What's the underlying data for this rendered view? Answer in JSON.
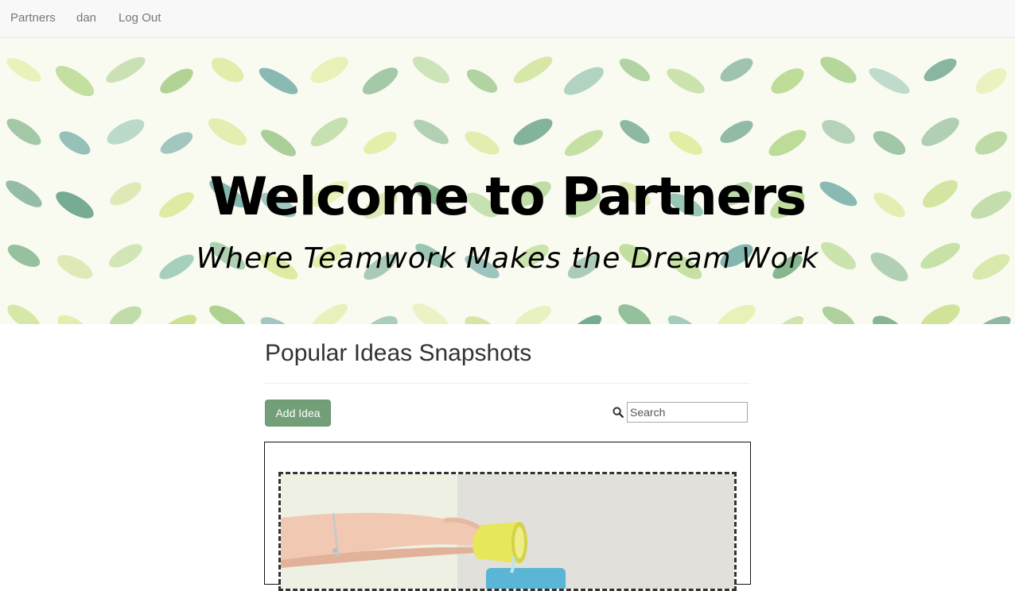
{
  "navbar": {
    "brand": "Partners",
    "user": "dan",
    "logout": "Log Out"
  },
  "hero": {
    "title": "Welcome to Partners",
    "subtitle": "Where Teamwork Makes the Dream Work"
  },
  "main": {
    "title": "Popular Ideas Snapshots",
    "add_idea_label": "Add Idea",
    "search_placeholder": "Search",
    "search_icon": "search-icon"
  },
  "snapshot": {
    "image_description": "hand-pouring-yellow-cup-photo"
  },
  "colors": {
    "accent": "#739f78",
    "navbar_bg": "#f8f8f8",
    "nav_text": "#777777"
  }
}
